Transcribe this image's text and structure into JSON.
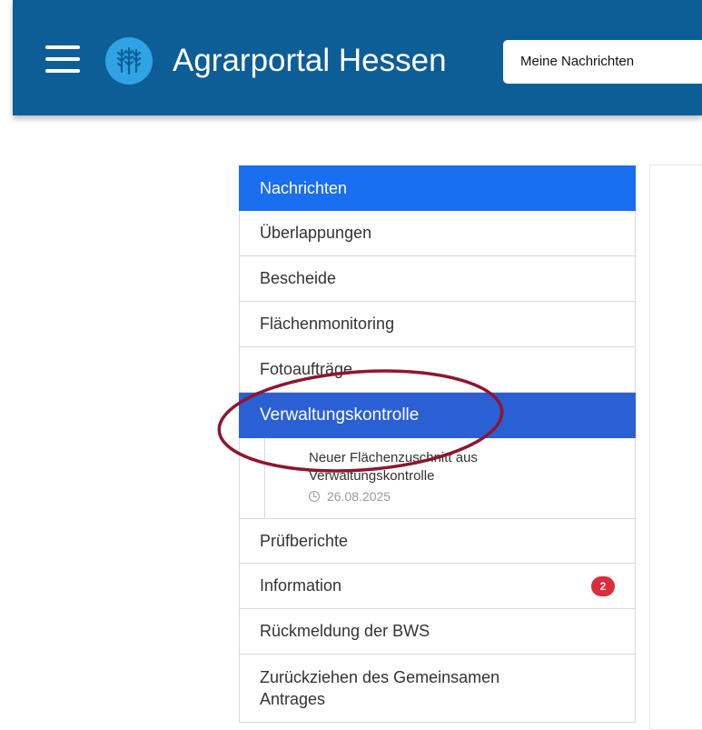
{
  "header": {
    "title": "Agrarportal Hessen",
    "messages_button": "Meine Nachrichten",
    "menu_icon": "hamburger-menu-icon",
    "logo_icon": "wheat-logo-icon"
  },
  "nav": {
    "items_top": [
      {
        "label": "Nachrichten"
      },
      {
        "label": "Überlappungen"
      },
      {
        "label": "Bescheide"
      },
      {
        "label": "Flächenmonitoring"
      },
      {
        "label": "Fotoaufträge"
      },
      {
        "label": "Verwaltungskontrolle"
      }
    ],
    "sub_entry": {
      "title": "Neuer Flächenzuschnitt aus Verwaltungskontrolle",
      "date": "26.08.2025"
    },
    "items_bottom": [
      {
        "label": "Prüfberichte"
      },
      {
        "label": "Information",
        "badge": "2"
      },
      {
        "label": "Rückmeldung der BWS"
      },
      {
        "label": "Zurückziehen des Gemeinsamen Antrages"
      }
    ]
  },
  "colors": {
    "header_bg": "#0d5e96",
    "active_item": "#1a6ef0",
    "selected_item": "#2b5fd4",
    "badge": "#dc2d3a",
    "annotation_ellipse": "#8e1630"
  }
}
